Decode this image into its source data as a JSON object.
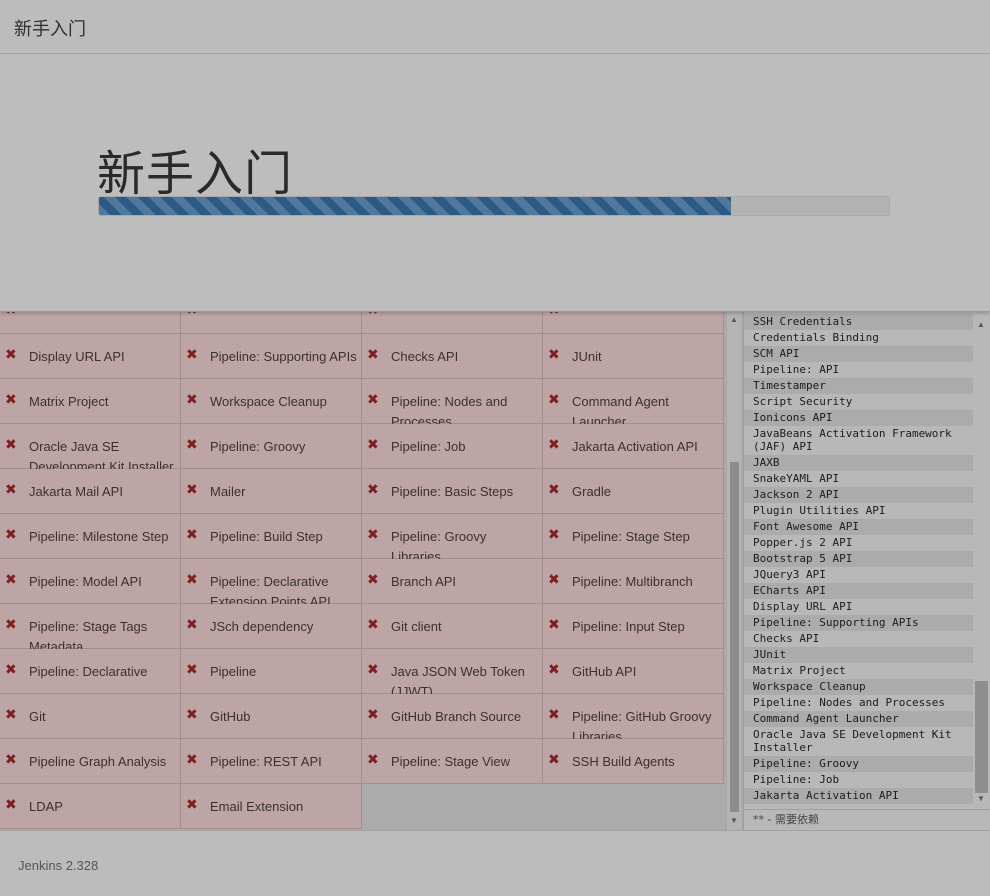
{
  "header": {
    "title": "新手入门"
  },
  "hero": {
    "title": "新手入门",
    "progress": 0.8
  },
  "colors": {
    "progress_fill": "#2b5b85",
    "failed_cell": "#bea5a5",
    "failed_icon": "#7f1f1f"
  },
  "plugins": [
    {
      "name": "",
      "icon": "close-icon"
    },
    {
      "name": "",
      "icon": "close-icon"
    },
    {
      "name": "",
      "icon": "close-icon"
    },
    {
      "name": "",
      "icon": "close-icon"
    },
    {
      "name": "Display URL API",
      "icon": "close-icon"
    },
    {
      "name": "Pipeline: Supporting APIs",
      "icon": "close-icon"
    },
    {
      "name": "Checks API",
      "icon": "close-icon"
    },
    {
      "name": "JUnit",
      "icon": "close-icon"
    },
    {
      "name": "Matrix Project",
      "icon": "close-icon"
    },
    {
      "name": "Workspace Cleanup",
      "icon": "close-icon"
    },
    {
      "name": "Pipeline: Nodes and Processes",
      "icon": "close-icon"
    },
    {
      "name": "Command Agent Launcher",
      "icon": "close-icon"
    },
    {
      "name": "Oracle Java SE Development Kit Installer",
      "icon": "close-icon"
    },
    {
      "name": "Pipeline: Groovy",
      "icon": "close-icon"
    },
    {
      "name": "Pipeline: Job",
      "icon": "close-icon"
    },
    {
      "name": "Jakarta Activation API",
      "icon": "close-icon"
    },
    {
      "name": "Jakarta Mail API",
      "icon": "close-icon"
    },
    {
      "name": "Mailer",
      "icon": "close-icon"
    },
    {
      "name": "Pipeline: Basic Steps",
      "icon": "close-icon"
    },
    {
      "name": "Gradle",
      "icon": "close-icon"
    },
    {
      "name": "Pipeline: Milestone Step",
      "icon": "close-icon"
    },
    {
      "name": "Pipeline: Build Step",
      "icon": "close-icon"
    },
    {
      "name": "Pipeline: Groovy Libraries",
      "icon": "close-icon"
    },
    {
      "name": "Pipeline: Stage Step",
      "icon": "close-icon"
    },
    {
      "name": "Pipeline: Model API",
      "icon": "close-icon"
    },
    {
      "name": "Pipeline: Declarative Extension Points API",
      "icon": "close-icon"
    },
    {
      "name": "Branch API",
      "icon": "close-icon"
    },
    {
      "name": "Pipeline: Multibranch",
      "icon": "close-icon"
    },
    {
      "name": "Pipeline: Stage Tags Metadata",
      "icon": "close-icon"
    },
    {
      "name": "JSch dependency",
      "icon": "close-icon"
    },
    {
      "name": "Git client",
      "icon": "close-icon"
    },
    {
      "name": "Pipeline: Input Step",
      "icon": "close-icon"
    },
    {
      "name": "Pipeline: Declarative",
      "icon": "close-icon"
    },
    {
      "name": "Pipeline",
      "icon": "close-icon"
    },
    {
      "name": "Java JSON Web Token (JJWT)",
      "icon": "close-icon"
    },
    {
      "name": "GitHub API",
      "icon": "close-icon"
    },
    {
      "name": "Git",
      "icon": "close-icon"
    },
    {
      "name": "GitHub",
      "icon": "close-icon"
    },
    {
      "name": "GitHub Branch Source",
      "icon": "close-icon"
    },
    {
      "name": "Pipeline: GitHub Groovy Libraries",
      "icon": "close-icon"
    },
    {
      "name": "Pipeline Graph Analysis",
      "icon": "close-icon"
    },
    {
      "name": "Pipeline: REST API",
      "icon": "close-icon"
    },
    {
      "name": "Pipeline: Stage View",
      "icon": "close-icon"
    },
    {
      "name": "SSH Build Agents",
      "icon": "close-icon"
    },
    {
      "name": "LDAP",
      "icon": "close-icon"
    },
    {
      "name": "Email Extension",
      "icon": "close-icon"
    }
  ],
  "install_log": {
    "items": [
      "SSH Credentials",
      "Credentials Binding",
      "SCM API",
      "Pipeline: API",
      "Timestamper",
      "Script Security",
      "Ionicons API",
      "JavaBeans Activation Framework (JAF) API",
      "JAXB",
      "SnakeYAML API",
      "Jackson 2 API",
      "Plugin Utilities API",
      "Font Awesome API",
      "Popper.js 2 API",
      "Bootstrap 5 API",
      "JQuery3 API",
      "ECharts API",
      "Display URL API",
      "Pipeline: Supporting APIs",
      "Checks API",
      "JUnit",
      "Matrix Project",
      "Workspace Cleanup",
      "Pipeline: Nodes and Processes",
      "Command Agent Launcher",
      "Oracle Java SE Development Kit Installer",
      "Pipeline: Groovy",
      "Pipeline: Job",
      "Jakarta Activation API"
    ],
    "footer": "** - 需要依赖"
  },
  "footer": {
    "version": "Jenkins 2.328"
  }
}
